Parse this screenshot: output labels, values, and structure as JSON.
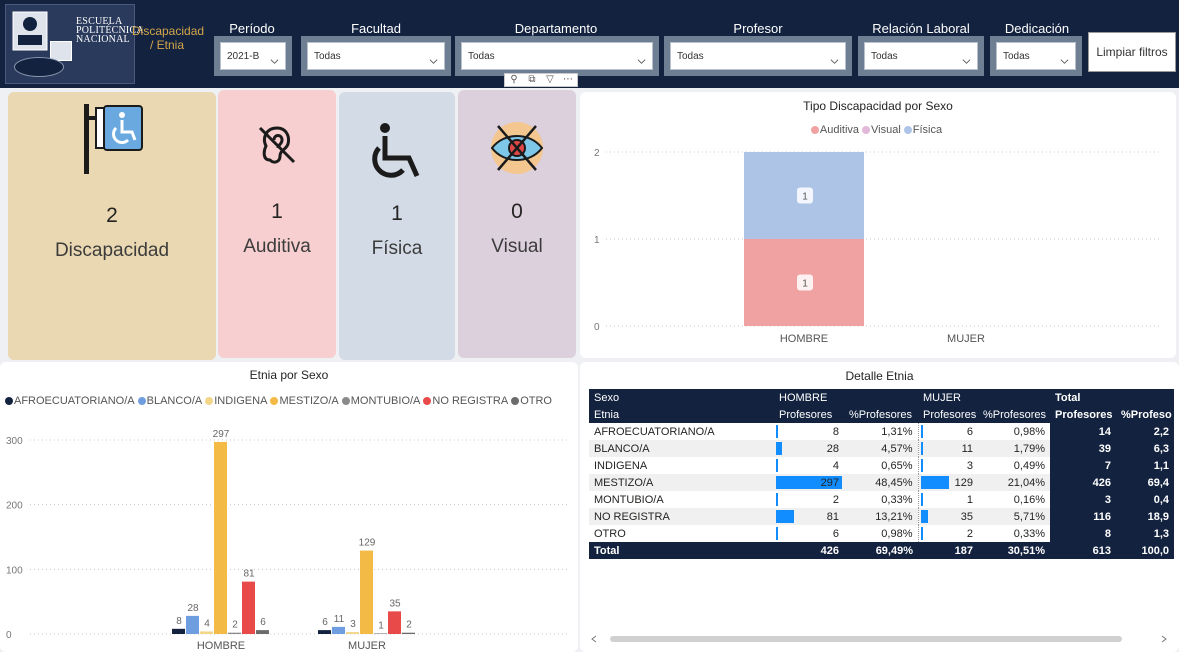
{
  "header": {
    "logo_lines": [
      "ESCUELA",
      "POLITÉCNICA",
      "NACIONAL"
    ],
    "page_name": "Discapacidad / Etnia",
    "clear_filters": "Limpiar filtros",
    "visual_tools": [
      "pin-icon",
      "copy-icon",
      "filter-icon",
      "more-icon"
    ]
  },
  "filters": [
    {
      "label": "Período",
      "value": "2021-B"
    },
    {
      "label": "Facultad",
      "value": "Todas"
    },
    {
      "label": "Departamento",
      "value": "Todas"
    },
    {
      "label": "Profesor",
      "value": "Todas"
    },
    {
      "label": "Relación Laboral",
      "value": "Todas"
    },
    {
      "label": "Dedicación",
      "value": "Todas"
    }
  ],
  "kpis": [
    {
      "value": "2",
      "label": "Discapacidad",
      "icon": "disability-sign-icon",
      "bg": "#e9d8b1"
    },
    {
      "value": "1",
      "label": "Auditiva",
      "icon": "hearing-impaired-icon",
      "bg": "#f7cfd0"
    },
    {
      "value": "1",
      "label": "Física",
      "icon": "wheelchair-icon",
      "bg": "#d3dbe6"
    },
    {
      "value": "0",
      "label": "Visual",
      "icon": "visual-impaired-icon",
      "bg": "#dcd0dd"
    }
  ],
  "disability_chart": {
    "title": "Tipo Discapacidad por Sexo",
    "legend": [
      {
        "name": "Auditiva",
        "color": "#f0a2a2"
      },
      {
        "name": "Visual",
        "color": "#e2b8d8"
      },
      {
        "name": "Física",
        "color": "#aec4e6"
      }
    ]
  },
  "ethnicity_chart": {
    "title": "Etnia por Sexo",
    "legend": [
      {
        "name": "AFROECUATORIANO/A",
        "color": "#13223f"
      },
      {
        "name": "BLANCO/A",
        "color": "#6f9ee0"
      },
      {
        "name": "INDIGENA",
        "color": "#f2d68a"
      },
      {
        "name": "MESTIZO/A",
        "color": "#f3ba45"
      },
      {
        "name": "MONTUBIO/A",
        "color": "#8a8a8a"
      },
      {
        "name": "NO REGISTRA",
        "color": "#e84a4a"
      },
      {
        "name": "OTRO",
        "color": "#6b6b6b"
      }
    ]
  },
  "chart_data": [
    {
      "type": "bar",
      "title": "Tipo Discapacidad por Sexo",
      "stacked": true,
      "categories": [
        "HOMBRE",
        "MUJER"
      ],
      "series": [
        {
          "name": "Auditiva",
          "values": [
            1,
            0
          ]
        },
        {
          "name": "Visual",
          "values": [
            0,
            0
          ]
        },
        {
          "name": "Física",
          "values": [
            1,
            0
          ]
        }
      ],
      "y_ticks": [
        "0",
        "1",
        "2"
      ],
      "ylim": [
        0,
        2
      ],
      "grid": true,
      "legend_position": "top-center"
    },
    {
      "type": "bar",
      "title": "Etnia por Sexo",
      "categories": [
        "HOMBRE",
        "MUJER"
      ],
      "series": [
        {
          "name": "AFROECUATORIANO/A",
          "values": [
            8,
            6
          ]
        },
        {
          "name": "BLANCO/A",
          "values": [
            28,
            11
          ]
        },
        {
          "name": "INDIGENA",
          "values": [
            4,
            3
          ]
        },
        {
          "name": "MESTIZO/A",
          "values": [
            297,
            129
          ]
        },
        {
          "name": "MONTUBIO/A",
          "values": [
            2,
            1
          ]
        },
        {
          "name": "NO REGISTRA",
          "values": [
            81,
            35
          ]
        },
        {
          "name": "OTRO",
          "values": [
            6,
            2
          ]
        }
      ],
      "y_ticks": [
        "0",
        "100",
        "200",
        "300"
      ],
      "ylim": [
        0,
        300
      ],
      "grid": true,
      "legend_position": "top"
    }
  ],
  "detail_table": {
    "title": "Detalle Etnia",
    "header_row1": [
      "Sexo",
      "HOMBRE",
      "",
      "MUJER",
      "",
      "Total",
      ""
    ],
    "header_row2": [
      "Etnia",
      "Profesores",
      "%Profesores",
      "Profesores",
      "%Profesores",
      "Profesores",
      "%Profeso"
    ],
    "rows": [
      {
        "etnia": "AFROECUATORIANO/A",
        "h": 8,
        "hp": "1,31%",
        "m": 6,
        "mp": "0,98%",
        "t": "14",
        "tp": "2,2"
      },
      {
        "etnia": "BLANCO/A",
        "h": 28,
        "hp": "4,57%",
        "m": 11,
        "mp": "1,79%",
        "t": "39",
        "tp": "6,3"
      },
      {
        "etnia": "INDIGENA",
        "h": 4,
        "hp": "0,65%",
        "m": 3,
        "mp": "0,49%",
        "t": "7",
        "tp": "1,1"
      },
      {
        "etnia": "MESTIZO/A",
        "h": 297,
        "hp": "48,45%",
        "m": 129,
        "mp": "21,04%",
        "t": "426",
        "tp": "69,4"
      },
      {
        "etnia": "MONTUBIO/A",
        "h": 2,
        "hp": "0,33%",
        "m": 1,
        "mp": "0,16%",
        "t": "3",
        "tp": "0,4"
      },
      {
        "etnia": "NO REGISTRA",
        "h": 81,
        "hp": "13,21%",
        "m": 35,
        "mp": "5,71%",
        "t": "116",
        "tp": "18,9"
      },
      {
        "etnia": "OTRO",
        "h": 6,
        "hp": "0,98%",
        "m": 2,
        "mp": "0,33%",
        "t": "8",
        "tp": "1,3"
      }
    ],
    "total": {
      "label": "Total",
      "h": "426",
      "hp": "69,49%",
      "m": "187",
      "mp": "30,51%",
      "t": "613",
      "tp": "100,0"
    },
    "bar_max": 297
  }
}
